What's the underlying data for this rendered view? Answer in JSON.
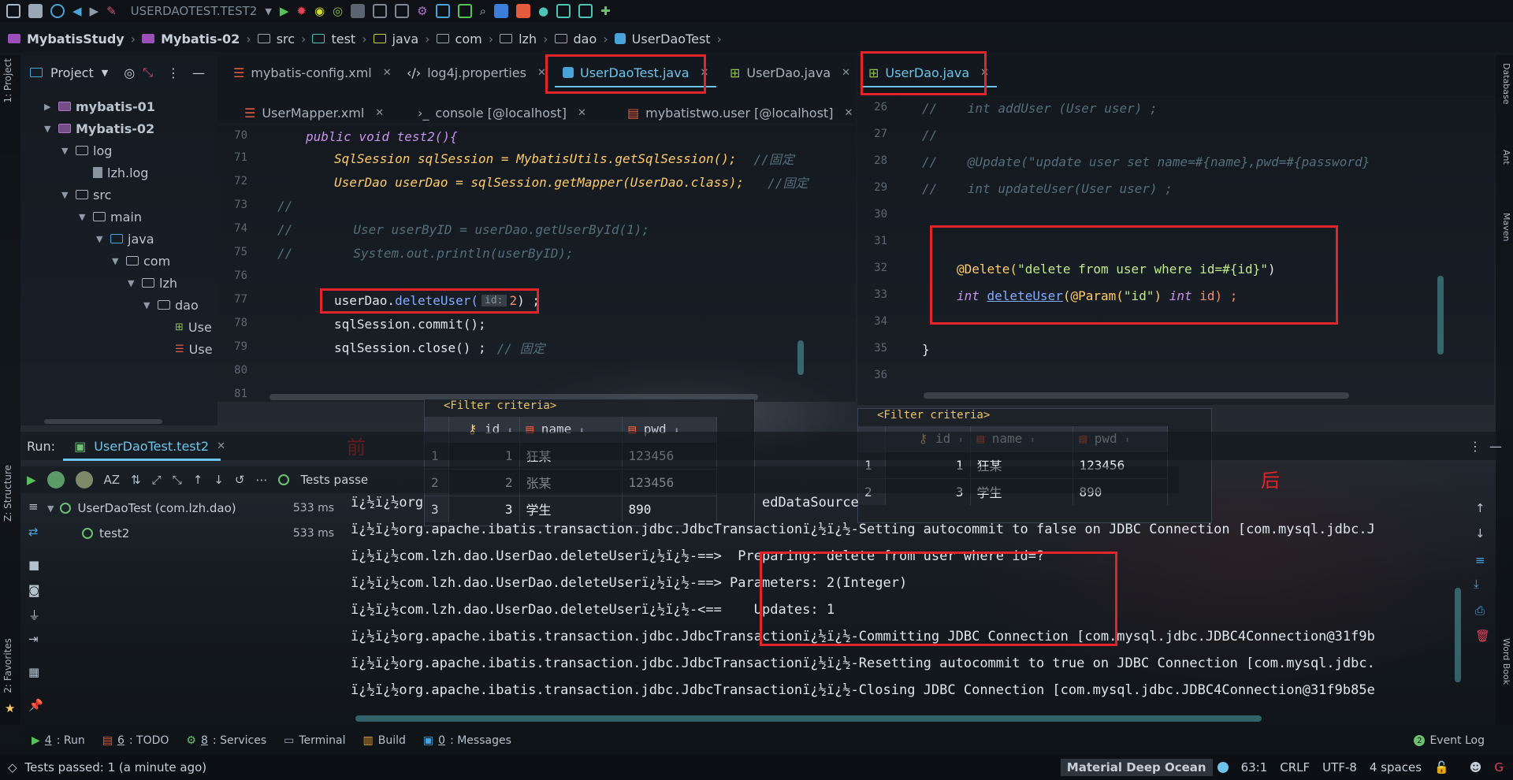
{
  "toolbar": {
    "run_config": "USERDAOTEST.TEST2"
  },
  "breadcrumb": [
    "MybatisStudy",
    "Mybatis-02",
    "src",
    "test",
    "java",
    "com",
    "lzh",
    "dao",
    "UserDaoTest"
  ],
  "project": {
    "header": "Project",
    "tree": [
      {
        "label": "mybatis-01"
      },
      {
        "label": "Mybatis-02"
      },
      {
        "label": "log"
      },
      {
        "label": "lzh.log"
      },
      {
        "label": "src"
      },
      {
        "label": "main"
      },
      {
        "label": "java"
      },
      {
        "label": "com"
      },
      {
        "label": "lzh"
      },
      {
        "label": "dao"
      },
      {
        "label": "Use"
      },
      {
        "label": "Use"
      }
    ]
  },
  "left_strip": {
    "project": "1: Project",
    "structure": "Z: Structure",
    "favorites": "2: Favorites"
  },
  "right_strip": {
    "database": "Database",
    "ant": "Ant",
    "maven": "Maven",
    "wordbook": "Word Book"
  },
  "tabs_left_row1": [
    {
      "label": "mybatis-config.xml"
    },
    {
      "label": "log4j.properties"
    },
    {
      "label": "UserDaoTest.java"
    },
    {
      "label": "UserDao.java"
    }
  ],
  "tabs_left_row2": [
    {
      "label": "UserMapper.xml"
    },
    {
      "label": "console [@localhost]"
    },
    {
      "label": "mybatistwo.user [@localhost]"
    }
  ],
  "tab_right": {
    "label": "UserDao.java"
  },
  "left_editor": {
    "lines": [
      {
        "num": "70",
        "text": "public void test2(){"
      },
      {
        "num": "71",
        "text": "SqlSession sqlSession = MybatisUtils.getSqlSession();",
        "comment": "//固定"
      },
      {
        "num": "72",
        "text": "UserDao userDao = sqlSession.getMapper(UserDao.class);",
        "comment": "//固定"
      },
      {
        "num": "73",
        "text": "//"
      },
      {
        "num": "74",
        "text": "//        User userByID = userDao.getUserById(1);"
      },
      {
        "num": "75",
        "text": "//        System.out.println(userByID);"
      },
      {
        "num": "76",
        "text": ""
      },
      {
        "num": "77",
        "pre": "userDao.",
        "fn": "deleteUser(",
        "hint": "id:",
        "arg": "2",
        "post": ") ;"
      },
      {
        "num": "78",
        "text": "sqlSession.commit();"
      },
      {
        "num": "79",
        "text": "sqlSession.close() ;",
        "comment": "// 固定"
      },
      {
        "num": "80",
        "text": ""
      },
      {
        "num": "81",
        "text": ""
      }
    ]
  },
  "right_editor": {
    "lines": [
      {
        "num": "26",
        "text": "//    int addUser (User user) ;"
      },
      {
        "num": "27",
        "text": "//"
      },
      {
        "num": "28",
        "text": "//    @Update(\"update user set name=#{name},pwd=#{password}"
      },
      {
        "num": "29",
        "text": "//    int updateUser(User user) ;"
      },
      {
        "num": "30",
        "text": ""
      },
      {
        "num": "31",
        "text": ""
      },
      {
        "num": "32",
        "ann": "@Delete(",
        "str": "\"delete from user where id=#{id}\"",
        "close": ")"
      },
      {
        "num": "33",
        "kw": "int ",
        "fn": "deleteUser",
        "rest1": "(@Param(",
        "str": "\"id\"",
        "rest2": ") ",
        "kw2": "int ",
        "rest3": "id) ;"
      },
      {
        "num": "34",
        "text": ""
      },
      {
        "num": "35",
        "text": "}"
      },
      {
        "num": "36",
        "text": ""
      }
    ]
  },
  "grid_before": {
    "filter": "<Filter criteria>",
    "columns": [
      "id",
      "name",
      "pwd"
    ],
    "rows": [
      {
        "rn": "1",
        "id": "1",
        "name": "狂某",
        "pwd": "123456"
      },
      {
        "rn": "2",
        "id": "2",
        "name": "张某",
        "pwd": "123456"
      },
      {
        "rn": "3",
        "id": "3",
        "name": "学生",
        "pwd": "890"
      }
    ]
  },
  "grid_after": {
    "filter": "<Filter criteria>",
    "columns": [
      "id",
      "name",
      "pwd"
    ],
    "rows": [
      {
        "rn": "1",
        "id": "1",
        "name": "狂某",
        "pwd": "123456"
      },
      {
        "rn": "2",
        "id": "3",
        "name": "学生",
        "pwd": "890"
      }
    ]
  },
  "labels": {
    "before": "前",
    "after": "后"
  },
  "run": {
    "label": "Run:",
    "tab": "UserDaoTest.test2",
    "tests_passed": "Tests passe",
    "tree": [
      {
        "label": "UserDaoTest (com.lzh.dao)",
        "time": "533 ms"
      },
      {
        "label": "test2",
        "time": "533 ms"
      }
    ],
    "console": [
      "ï¿½ï¿½org                                          edDataSource",
      "ï¿½ï¿½org.apache.ibatis.transaction.jdbc.JdbcTransactionï¿½ï¿½-Setting autocommit to false on JDBC Connection [com.mysql.jdbc.J",
      "ï¿½ï¿½com.lzh.dao.UserDao.deleteUserï¿½ï¿½-==>  Preparing: delete from user where id=?",
      "ï¿½ï¿½com.lzh.dao.UserDao.deleteUserï¿½ï¿½-==> Parameters: 2(Integer)",
      "ï¿½ï¿½com.lzh.dao.UserDao.deleteUserï¿½ï¿½-<==    Updates: 1",
      "ï¿½ï¿½org.apache.ibatis.transaction.jdbc.JdbcTransactionï¿½ï¿½-Committing JDBC Connection [com.mysql.jdbc.JDBC4Connection@31f9b",
      "ï¿½ï¿½org.apache.ibatis.transaction.jdbc.JdbcTransactionï¿½ï¿½-Resetting autocommit to true on JDBC Connection [com.mysql.jdbc.",
      "ï¿½ï¿½org.apache.ibatis.transaction.jdbc.JdbcTransactionï¿½ï¿½-Closing JDBC Connection [com.mysql.jdbc.JDBC4Connection@31f9b85e"
    ]
  },
  "toolwindows": [
    {
      "num": "4",
      "label": ": Run"
    },
    {
      "num": "6",
      "label": ": TODO"
    },
    {
      "num": "8",
      "label": ": Services"
    },
    {
      "num": "",
      "label": "Terminal"
    },
    {
      "num": "",
      "label": "Build"
    },
    {
      "num": "0",
      "label": ": Messages"
    }
  ],
  "event_log": "Event Log",
  "status": {
    "left": "Tests passed: 1 (a minute ago)",
    "theme": "Material Deep Ocean",
    "position": "63:1",
    "line_sep": "CRLF",
    "encoding": "UTF-8",
    "indent": "4 spaces"
  },
  "colors": {
    "accent": "#6ec3e8",
    "highlight": "#e3242b",
    "success": "#6cc070"
  }
}
